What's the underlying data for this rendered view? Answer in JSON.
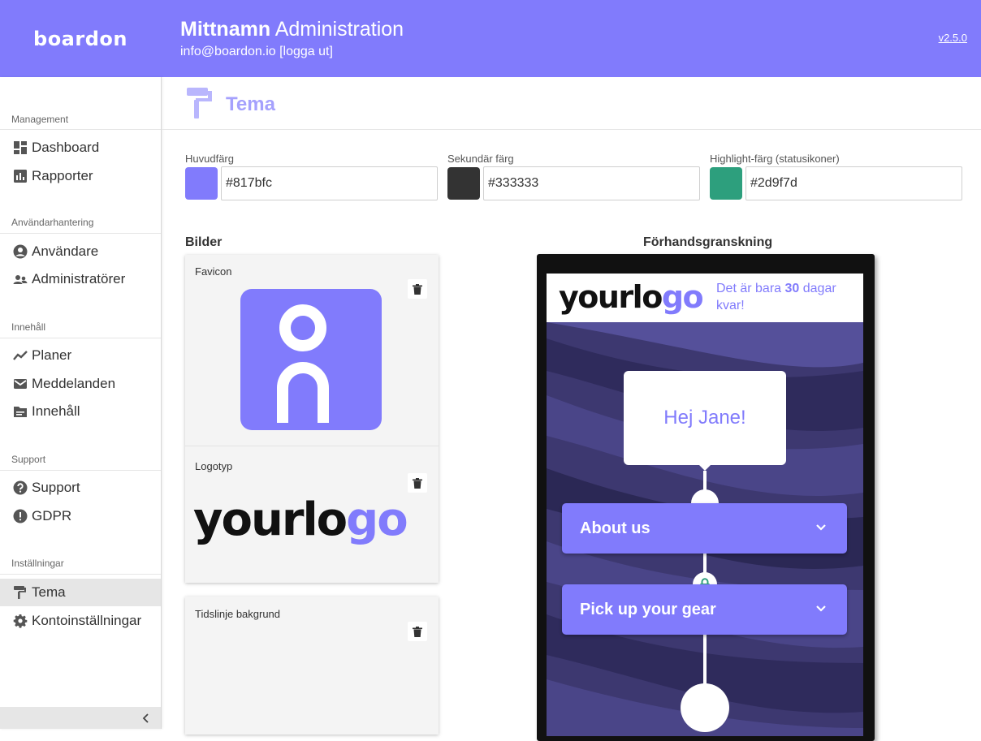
{
  "header": {
    "brand": "boardon",
    "title_bold": "Mittnamn",
    "title_rest": "Administration",
    "email": "info@boardon.io",
    "logout": "[logga ut]",
    "version": "v2.5.0"
  },
  "sidebar": {
    "sections": [
      {
        "title": "Management",
        "items": [
          {
            "label": "Dashboard",
            "icon": "dashboard-icon"
          },
          {
            "label": "Rapporter",
            "icon": "bar-chart-icon"
          }
        ]
      },
      {
        "title": "Användarhantering",
        "items": [
          {
            "label": "Användare",
            "icon": "user-icon"
          },
          {
            "label": "Administratörer",
            "icon": "users-icon"
          }
        ]
      },
      {
        "title": "Innehåll",
        "items": [
          {
            "label": "Planer",
            "icon": "trend-line-icon"
          },
          {
            "label": "Meddelanden",
            "icon": "envelope-icon"
          },
          {
            "label": "Innehåll",
            "icon": "folder-icon"
          }
        ]
      },
      {
        "title": "Support",
        "items": [
          {
            "label": "Support",
            "icon": "question-icon"
          },
          {
            "label": "GDPR",
            "icon": "alert-icon"
          }
        ]
      },
      {
        "title": "Inställningar",
        "items": [
          {
            "label": "Tema",
            "icon": "paint-roller-icon",
            "active": true
          },
          {
            "label": "Kontoinställningar",
            "icon": "gear-icon"
          }
        ]
      }
    ],
    "collapse_icon": "chevron-left-icon"
  },
  "page": {
    "title": "Tema",
    "icon": "paint-roller-icon"
  },
  "colors": [
    {
      "label": "Huvudfärg",
      "value": "#817bfc",
      "swatch": "#817bfc"
    },
    {
      "label": "Sekundär färg",
      "value": "#333333",
      "swatch": "#333333"
    },
    {
      "label": "Highlight-färg (statusikoner)",
      "value": "#2d9f7d",
      "swatch": "#2d9f7d"
    }
  ],
  "images": {
    "title": "Bilder",
    "favicon_label": "Favicon",
    "logo_label": "Logotyp",
    "logo_text_dark": "yourlo",
    "logo_text_accent": "go",
    "background_label": "Tidslinje bakgrund",
    "delete_icon": "trash-icon"
  },
  "preview": {
    "title": "Förhandsgranskning",
    "logo_text_dark": "yourlo",
    "logo_text_accent": "go",
    "trial_before": "Det är bara",
    "trial_days": "30",
    "trial_after": "dagar kvar!",
    "greeting": "Hej Jane!",
    "steps": [
      "About us",
      "Pick up your gear"
    ],
    "lock_icon": "lock-icon",
    "chevron_icon": "chevron-down-icon"
  }
}
